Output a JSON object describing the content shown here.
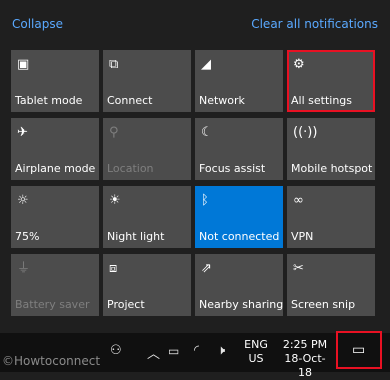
{
  "header": {
    "collapse_label": "Collapse",
    "clear_label": "Clear all notifications"
  },
  "tiles": [
    {
      "label": "Tablet mode",
      "icon": "tablet-icon",
      "state": "normal"
    },
    {
      "label": "Connect",
      "icon": "connect-icon",
      "state": "normal"
    },
    {
      "label": "Network",
      "icon": "network-icon",
      "state": "normal"
    },
    {
      "label": "All settings",
      "icon": "gear-icon",
      "state": "highlight"
    },
    {
      "label": "Airplane mode",
      "icon": "airplane-icon",
      "state": "normal"
    },
    {
      "label": "Location",
      "icon": "location-icon",
      "state": "disabled"
    },
    {
      "label": "Focus assist",
      "icon": "moon-icon",
      "state": "normal"
    },
    {
      "label": "Mobile hotspot",
      "icon": "hotspot-icon",
      "state": "normal"
    },
    {
      "label": "75%",
      "icon": "brightness-icon",
      "state": "normal"
    },
    {
      "label": "Night light",
      "icon": "night-light-icon",
      "state": "normal"
    },
    {
      "label": "Not connected",
      "icon": "bluetooth-icon",
      "state": "active"
    },
    {
      "label": "VPN",
      "icon": "vpn-icon",
      "state": "normal"
    },
    {
      "label": "Battery saver",
      "icon": "battery-saver-icon",
      "state": "disabled"
    },
    {
      "label": "Project",
      "icon": "project-icon",
      "state": "normal"
    },
    {
      "label": "Nearby sharing",
      "icon": "share-icon",
      "state": "normal"
    },
    {
      "label": "Screen snip",
      "icon": "snip-icon",
      "state": "normal"
    }
  ],
  "taskbar": {
    "language_line1": "ENG",
    "language_line2": "US",
    "time": "2:25 PM",
    "date": "18-Oct-18",
    "icons": [
      "people-icon",
      "chevron-up-icon",
      "battery-icon",
      "wifi-icon",
      "volume-icon",
      "action-center-icon"
    ]
  },
  "watermark": "©Howtoconnect",
  "colors": {
    "accent": "#0078d7",
    "highlight_border": "#e81123",
    "tile": "#4c4c4c",
    "link": "#5aa9ff"
  }
}
